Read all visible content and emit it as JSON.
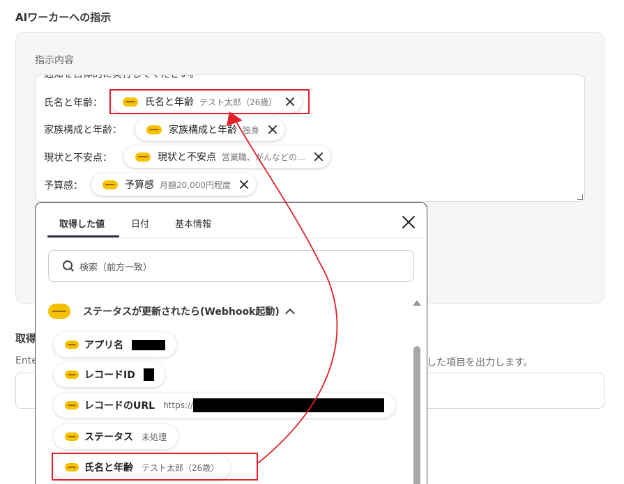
{
  "section": {
    "title": "AIワーカーへの指示"
  },
  "instruction_field": {
    "label": "指示内容",
    "partial_line": "通知を目体的に実行してください。"
  },
  "rows": [
    {
      "label": "氏名と年齢：",
      "chip_name": "氏名と年齢",
      "chip_value": "テスト太郎（26歳）"
    },
    {
      "label": "家族構成と年齢：",
      "chip_name": "家族構成と年齢",
      "chip_value": "独身"
    },
    {
      "label": "現状と不安点：",
      "chip_name": "現状と不安点",
      "chip_value": "営業職、がんなどの…"
    },
    {
      "label": "予算感：",
      "chip_name": "予算感",
      "chip_value": "月額20,000円程度"
    }
  ],
  "lower_section": {
    "title": "取得",
    "desc_left": "Ente",
    "desc_right": "した項目を出力します。"
  },
  "popup": {
    "tabs": [
      "取得した値",
      "日付",
      "基本情報"
    ],
    "active_tab": "取得した値",
    "search_placeholder": "検索（前方一致）",
    "group_title": "ステータスが更新されたら(Webhook起動)",
    "items": [
      {
        "name": "アプリ名",
        "value": ""
      },
      {
        "name": "レコードID",
        "value": ""
      },
      {
        "name": "レコードのURL",
        "value": "https://"
      },
      {
        "name": "ステータス",
        "value": "未処理"
      },
      {
        "name": "氏名と年齢",
        "value": "テスト太郎（26歳）"
      }
    ]
  },
  "colors": {
    "highlight": "#e0202a",
    "kintone_logo": "#f6c100",
    "panel_bg": "#f5f6f8"
  },
  "icons": [
    "kintone-logo-icon",
    "close-icon",
    "search-icon",
    "chevron-up-icon",
    "scroll-up-arrow-icon"
  ]
}
